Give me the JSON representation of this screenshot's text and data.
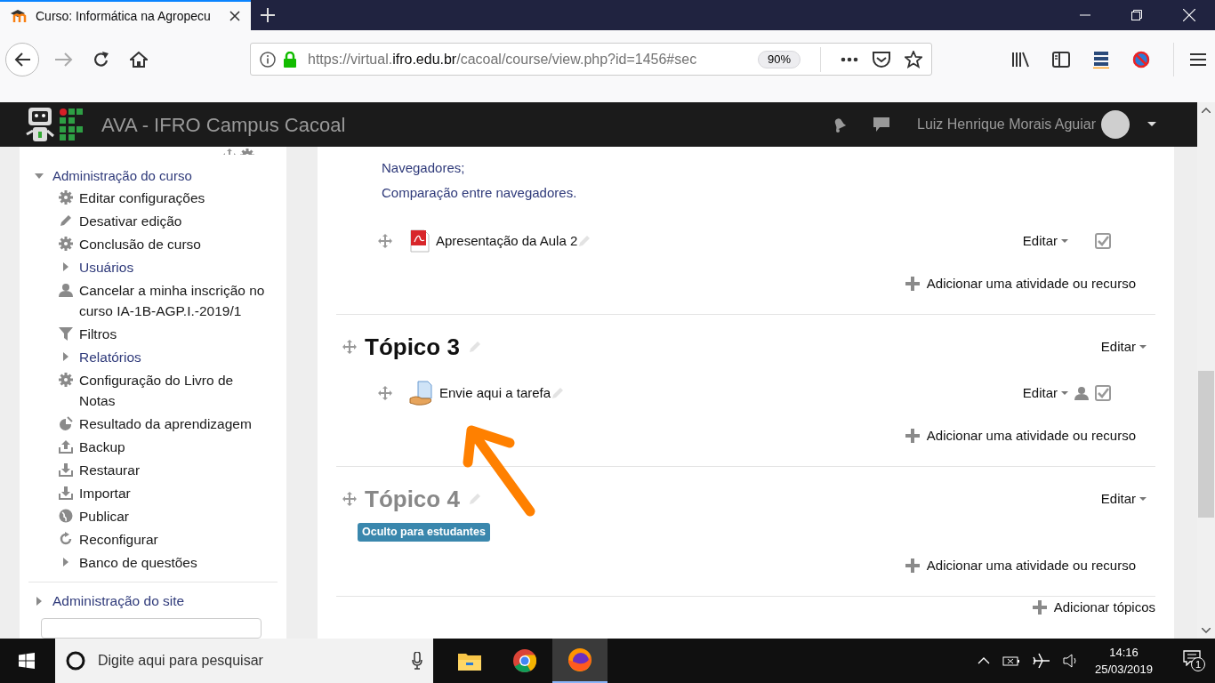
{
  "browser": {
    "tab": {
      "title": "Curso: Informática na Agropecu",
      "selected": true
    },
    "url": {
      "prefix": "https://virtual.",
      "domain": "ifro.edu.br",
      "path": "/cacoal/course/view.php?id=1456#sec"
    },
    "zoom": "90%"
  },
  "navbar": {
    "site_name": "AVA - IFRO Campus Cacoal",
    "user_name": "Luiz Henrique Morais Aguiar"
  },
  "sidebar": {
    "section": {
      "title": "Administração do curso",
      "expanded": true
    },
    "items": [
      {
        "label": "Editar configurações",
        "kind": "node"
      },
      {
        "label": "Desativar edição",
        "kind": "node"
      },
      {
        "label": "Conclusão de curso",
        "kind": "node"
      },
      {
        "label": "Usuários",
        "kind": "branch",
        "linked": true
      },
      {
        "label": "Cancelar a minha inscrição no curso IA-1B-AGP.I.-2019/1",
        "kind": "node"
      },
      {
        "label": "Filtros",
        "kind": "node"
      },
      {
        "label": "Relatórios",
        "kind": "branch",
        "linked": true
      },
      {
        "label": "Configuração do Livro de Notas",
        "kind": "node"
      },
      {
        "label": "Resultado da aprendizagem",
        "kind": "node"
      },
      {
        "label": "Backup",
        "kind": "node"
      },
      {
        "label": "Restaurar",
        "kind": "node"
      },
      {
        "label": "Importar",
        "kind": "node"
      },
      {
        "label": "Publicar",
        "kind": "node"
      },
      {
        "label": "Reconfigurar",
        "kind": "node"
      },
      {
        "label": "Banco de questões",
        "kind": "branch",
        "linked": false
      }
    ],
    "footer": {
      "title": "Administração do site",
      "expanded": false
    }
  },
  "sections": [
    {
      "summary_lines": [
        "Navegadores;",
        "Comparação entre navegadores."
      ],
      "activities": [
        {
          "name": "Apresentação da Aula 2",
          "kind": "pdf",
          "edit": "Editar",
          "group_mode": false
        }
      ],
      "add_label": "Adicionar uma atividade ou recurso"
    },
    {
      "title": "Tópico 3",
      "hidden": false,
      "edit": "Editar",
      "activities": [
        {
          "name": "Envie aqui a tarefa",
          "kind": "assignment",
          "edit": "Editar",
          "group_mode": true
        }
      ],
      "add_label": "Adicionar uma atividade ou recurso"
    },
    {
      "title": "Tópico 4",
      "hidden": true,
      "badge": "Oculto para estudantes",
      "edit": "Editar",
      "add_label": "Adicionar uma atividade ou recurso"
    }
  ],
  "add_topics": "Adicionar tópicos",
  "taskbar": {
    "search_placeholder": "Digite aqui para pesquisar",
    "apps": [
      {
        "kind": "explorer",
        "selected": false
      },
      {
        "kind": "chrome",
        "selected": false
      },
      {
        "kind": "firefox",
        "selected": true
      }
    ],
    "time": "14:16",
    "date": "25/03/2019",
    "notifications": "1"
  }
}
